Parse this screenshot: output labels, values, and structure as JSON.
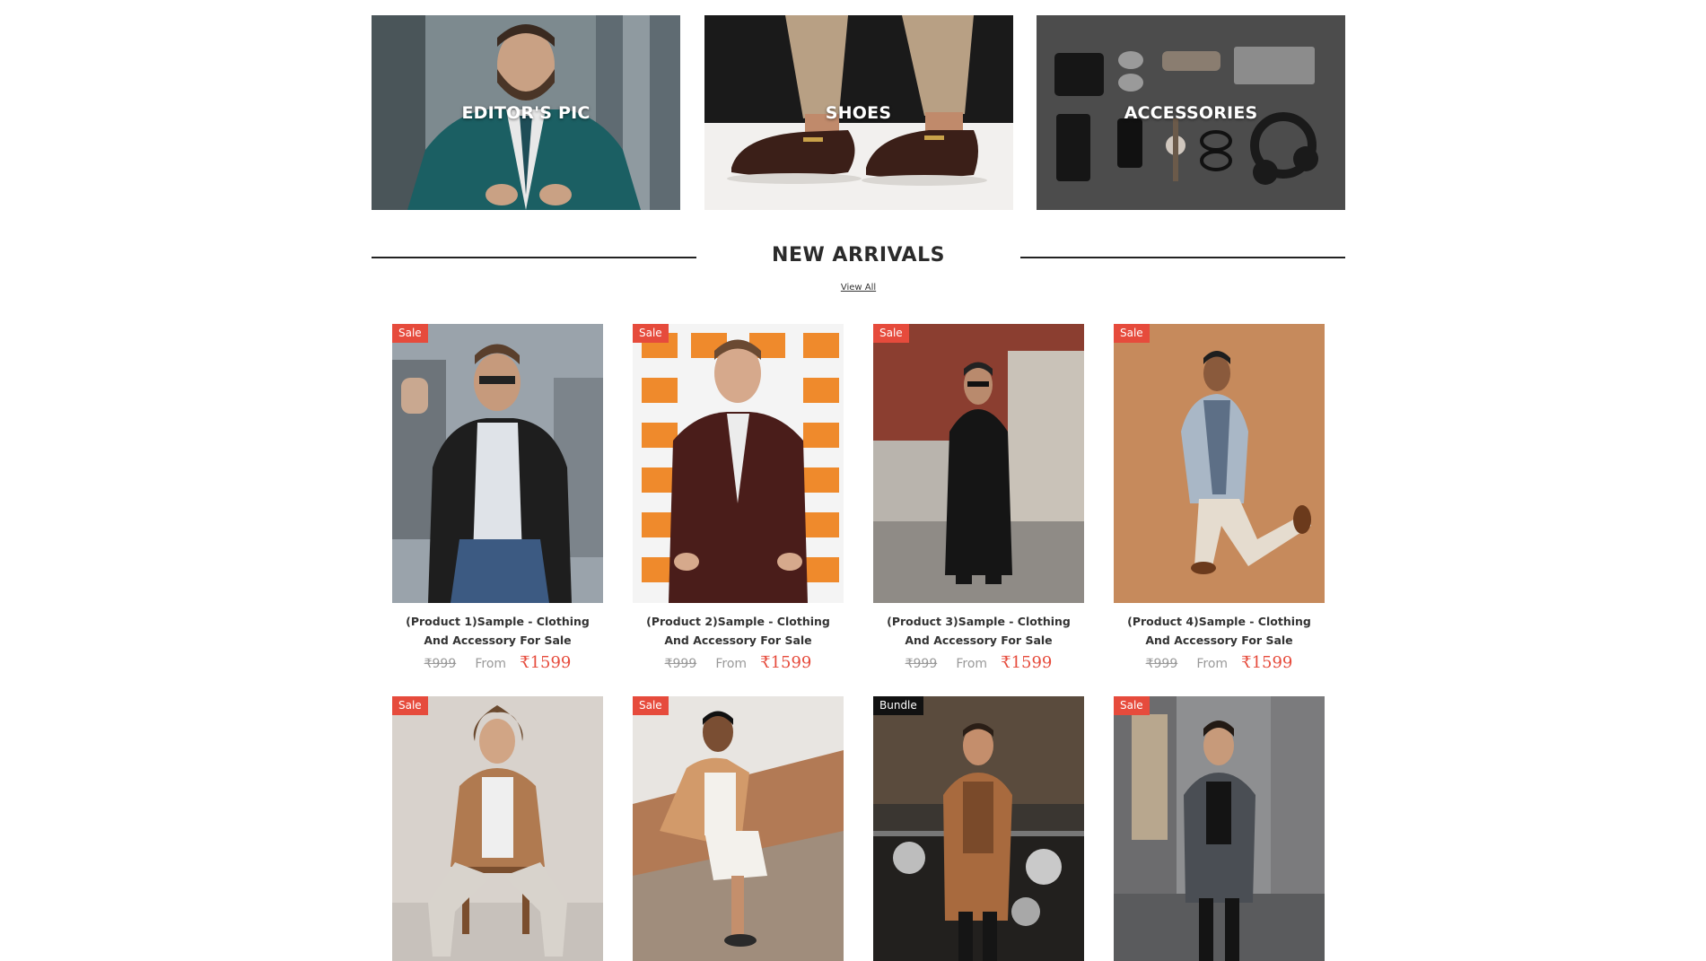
{
  "categories": [
    {
      "label": "EDITOR'S PIC"
    },
    {
      "label": "SHOES"
    },
    {
      "label": "ACCESSORIES"
    }
  ],
  "section": {
    "title": "NEW ARRIVALS",
    "view_all": "View All"
  },
  "products": [
    {
      "badge": "Sale",
      "name": "(Product 1)Sample - Clothing And Accessory For Sale",
      "price_old": "₹999",
      "from": "From",
      "price": "₹1599"
    },
    {
      "badge": "Sale",
      "name": "(Product 2)Sample - Clothing And Accessory For Sale",
      "price_old": "₹999",
      "from": "From",
      "price": "₹1599"
    },
    {
      "badge": "Sale",
      "name": "(Product 3)Sample - Clothing And Accessory For Sale",
      "price_old": "₹999",
      "from": "From",
      "price": "₹1599"
    },
    {
      "badge": "Sale",
      "name": "(Product 4)Sample - Clothing And Accessory For Sale",
      "price_old": "₹999",
      "from": "From",
      "price": "₹1599"
    },
    {
      "badge": "Sale"
    },
    {
      "badge": "Sale"
    },
    {
      "badge": "Bundle"
    },
    {
      "badge": "Sale"
    }
  ],
  "colors": {
    "sale_badge": "#e64b3c",
    "bundle_badge": "#111111",
    "price": "#e64b3c",
    "muted": "#999999",
    "heading": "#2b2b2b"
  }
}
